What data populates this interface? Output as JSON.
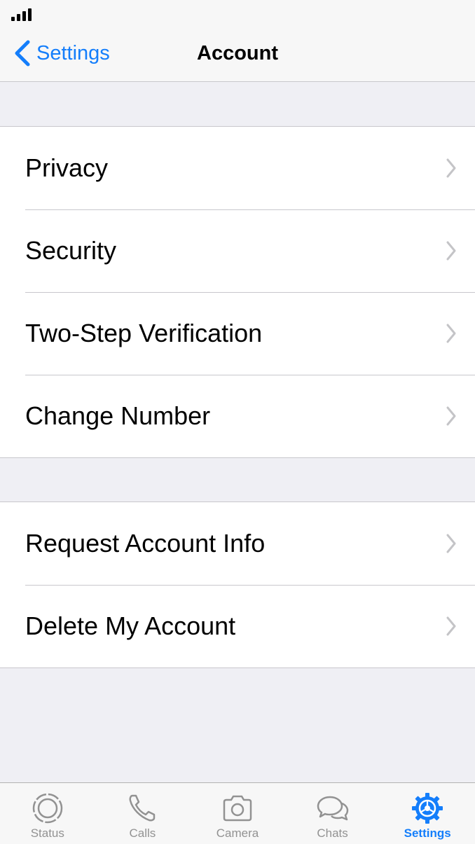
{
  "nav": {
    "back_label": "Settings",
    "title": "Account"
  },
  "groups": [
    {
      "rows": [
        {
          "label": "Privacy"
        },
        {
          "label": "Security"
        },
        {
          "label": "Two-Step Verification"
        },
        {
          "label": "Change Number"
        }
      ]
    },
    {
      "rows": [
        {
          "label": "Request Account Info"
        },
        {
          "label": "Delete My Account"
        }
      ]
    }
  ],
  "tabs": [
    {
      "label": "Status",
      "icon": "status-icon"
    },
    {
      "label": "Calls",
      "icon": "phone-icon"
    },
    {
      "label": "Camera",
      "icon": "camera-icon"
    },
    {
      "label": "Chats",
      "icon": "chat-bubbles-icon"
    },
    {
      "label": "Settings",
      "icon": "gear-icon",
      "active": true
    }
  ],
  "colors": {
    "accent": "#147efb",
    "inactive": "#929292",
    "background": "#efeff4"
  }
}
